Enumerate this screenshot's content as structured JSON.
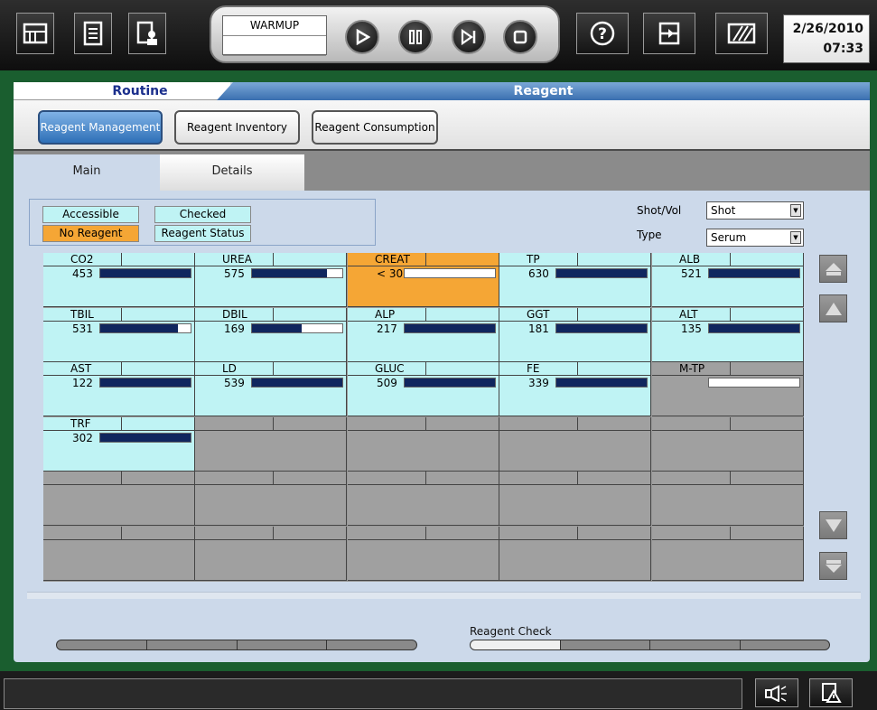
{
  "toolbar": {
    "status_mode": "WARMUP",
    "status_sub": "",
    "date": "2/26/2010",
    "time": "07:33"
  },
  "header": {
    "left_title": "Routine",
    "right_title": "Reagent"
  },
  "subtabs": [
    "Reagent Management",
    "Reagent Inventory",
    "Reagent Consumption"
  ],
  "tabs": [
    "Main",
    "Details"
  ],
  "legend": {
    "accessible": "Accessible",
    "checked": "Checked",
    "no_reagent": "No Reagent",
    "reagent_status": "Reagent Status"
  },
  "colors": {
    "accessible": "#bff3f4",
    "no_reagent": "#f5a635",
    "empty": "#a0a0a0",
    "bar": "#10265e"
  },
  "shot_vol": {
    "label": "Shot/Vol",
    "value": "Shot"
  },
  "type": {
    "label": "Type",
    "value": "Serum"
  },
  "reagents": [
    {
      "name": "CO2",
      "count": "453",
      "level": 1.0,
      "status": "accessible"
    },
    {
      "name": "UREA",
      "count": "575",
      "level": 0.83,
      "status": "accessible"
    },
    {
      "name": "CREAT",
      "count": "< 30",
      "level": 0.0,
      "status": "no_reagent"
    },
    {
      "name": "TP",
      "count": "630",
      "level": 1.0,
      "status": "accessible"
    },
    {
      "name": "ALB",
      "count": "521",
      "level": 1.0,
      "status": "accessible"
    },
    {
      "name": "TBIL",
      "count": "531",
      "level": 0.86,
      "status": "accessible"
    },
    {
      "name": "DBIL",
      "count": "169",
      "level": 0.55,
      "status": "accessible"
    },
    {
      "name": "ALP",
      "count": "217",
      "level": 1.0,
      "status": "accessible"
    },
    {
      "name": "GGT",
      "count": "181",
      "level": 1.0,
      "status": "accessible"
    },
    {
      "name": "ALT",
      "count": "135",
      "level": 1.0,
      "status": "accessible"
    },
    {
      "name": "AST",
      "count": "122",
      "level": 1.0,
      "status": "accessible"
    },
    {
      "name": "LD",
      "count": "539",
      "level": 1.0,
      "status": "accessible"
    },
    {
      "name": "GLUC",
      "count": "509",
      "level": 1.0,
      "status": "accessible"
    },
    {
      "name": "FE",
      "count": "339",
      "level": 1.0,
      "status": "accessible"
    },
    {
      "name": "M-TP",
      "count": "",
      "level": 0.0,
      "status": "empty_bar"
    },
    {
      "name": "TRF",
      "count": "302",
      "level": 1.0,
      "status": "accessible"
    }
  ],
  "reagent_check": {
    "label": "Reagent Check",
    "progress_segments_done": 1
  }
}
